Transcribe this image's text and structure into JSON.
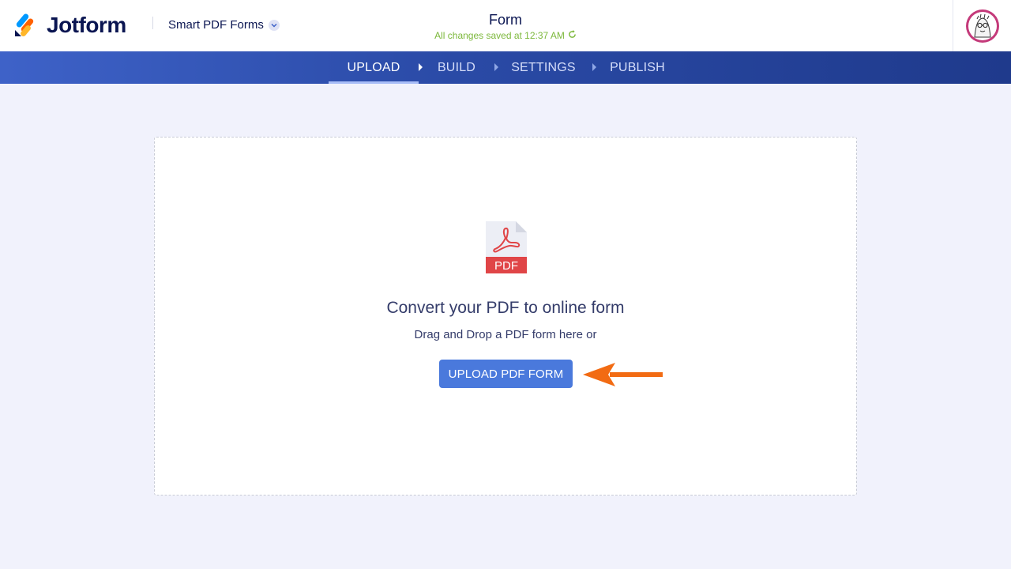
{
  "header": {
    "brand": "Jotform",
    "product_label": "Smart PDF Forms",
    "form_title": "Form",
    "save_status": "All changes saved at 12:37 AM"
  },
  "nav": {
    "tabs": [
      {
        "label": "UPLOAD",
        "active": true
      },
      {
        "label": "BUILD",
        "active": false
      },
      {
        "label": "SETTINGS",
        "active": false
      },
      {
        "label": "PUBLISH",
        "active": false
      }
    ]
  },
  "upload": {
    "icon_text": "PDF",
    "heading": "Convert your PDF to online form",
    "subtext": "Drag and Drop a PDF form here or",
    "button_label": "UPLOAD PDF FORM"
  },
  "icons": {
    "logo": "jotform-logo-icon",
    "dropdown": "chevron-down-icon",
    "refresh": "refresh-icon",
    "avatar": "user-avatar",
    "file": "pdf-file-icon",
    "pointer": "arrow-left-icon"
  },
  "colors": {
    "brand_navy": "#0a1551",
    "nav_blue": "#2a4aa6",
    "button_blue": "#4a79dc",
    "save_green": "#7cb83b",
    "pdf_red": "#e04547",
    "arrow_orange": "#f26b13",
    "page_bg": "#f1f2fc"
  }
}
